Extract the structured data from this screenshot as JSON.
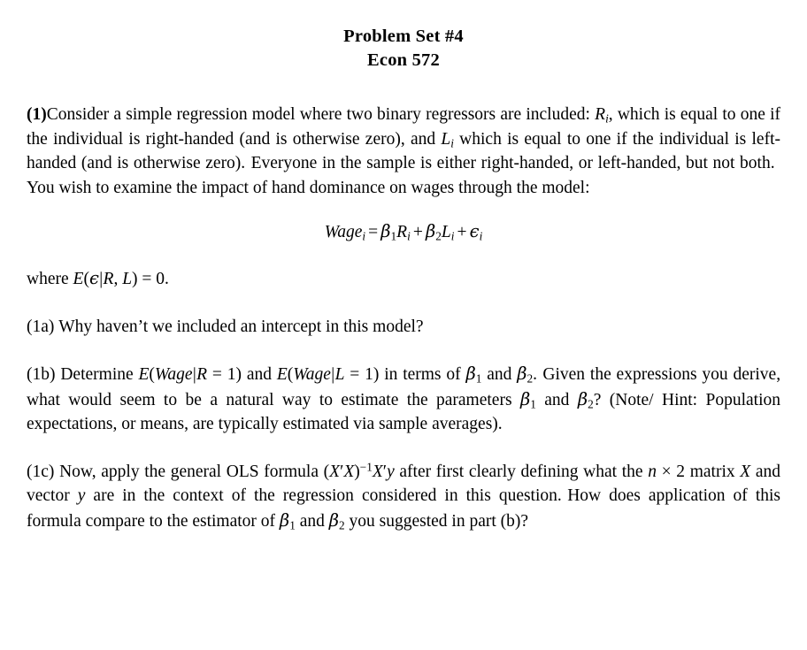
{
  "document": {
    "title_line1": "Problem Set #4",
    "title_line2": "Econ 572",
    "problem1": {
      "number_label": "(1)",
      "text_part1": "Consider a simple regression model where two binary regressors are included: ",
      "sym_R_i": "R",
      "sym_R_i_sub": "i",
      "text_part2": ", which is equal to one if the individual is right-handed (and is otherwise zero), and ",
      "sym_L_i": "L",
      "sym_L_i_sub": "i",
      "text_part3": " which is equal to one if the individual is left-handed (and is otherwise zero).",
      "text_part4": "Everyone in the sample is either right-handed, or left-handed, but not both.",
      "text_part5": "You wish to examine the impact of hand dominance on wages through the model:",
      "equation": {
        "lhs": "Wage",
        "lhs_sub": "i",
        "equals": "=",
        "beta1": "β",
        "beta1_sub": "1",
        "var_R": "R",
        "var_R_sub": "i",
        "plus1": "+",
        "beta2": "β",
        "beta2_sub": "2",
        "var_L": "L",
        "var_L_sub": "i",
        "plus2": "+",
        "eps": "ϵ",
        "eps_sub": "i"
      },
      "where_prefix": "where ",
      "where_E": "E",
      "where_open": "(",
      "where_eps": "ϵ",
      "where_bar": "|",
      "where_R": "R",
      "where_comma": ", ",
      "where_L": "L",
      "where_close": ")",
      "where_equals": " = ",
      "where_zero": "0."
    },
    "problem1a": {
      "label": "(1a)",
      "text": "Why haven’t we included an intercept in this model?"
    },
    "problem1b": {
      "label": "(1b)",
      "text_1": "Determine ",
      "expr1": {
        "E": "E",
        "open": "(",
        "arg": "Wage",
        "bar": "|",
        "cond": "R",
        "eq": " = ",
        "val": "1",
        "close": ")"
      },
      "text_2": " and ",
      "expr2": {
        "E": "E",
        "open": "(",
        "arg": "Wage",
        "bar": "|",
        "cond": "L",
        "eq": " = ",
        "val": "1",
        "close": ")"
      },
      "text_3": " in terms of ",
      "beta1": "β",
      "beta1_sub": "1",
      "text_4": " and ",
      "beta2": "β",
      "beta2_sub": "2",
      "text_5": ".",
      "text_6": "Given the expressions you derive, what would seem to be a natural way to estimate the parameters ",
      "beta1b": "β",
      "beta1b_sub": "1",
      "text_7": " and ",
      "beta2b": "β",
      "beta2b_sub": "2",
      "text_8": "? (Note/ Hint: Population expectations, or means, are typically estimated via sample averages)."
    },
    "problem1c": {
      "label": "(1c)",
      "text_1": "Now, apply the general OLS formula ",
      "formula": {
        "open": "(",
        "X1": "X",
        "prime1": "′",
        "X2": "X",
        "close": ")",
        "exp": "−1",
        "X3": "X",
        "prime2": "′",
        "y": "y"
      },
      "text_2": " after first clearly defining what the ",
      "matrix_n": "n",
      "matrix_times": " × ",
      "matrix_2": "2",
      "text_3": " matrix ",
      "matrix_X": "X",
      "text_4": " and vector ",
      "vector_y": "y",
      "text_5": " are in the context of the regression considered in this question.",
      "text_6": "How does application of this formula compare to the estimator of ",
      "beta1": "β",
      "beta1_sub": "1",
      "text_7": " and ",
      "beta2": "β",
      "beta2_sub": "2",
      "text_8": " you suggested in part (b)?"
    }
  }
}
